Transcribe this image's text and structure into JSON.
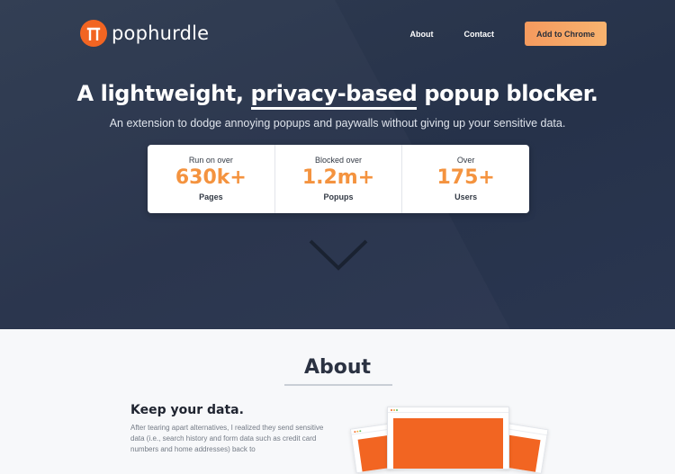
{
  "brand": {
    "name": "pophurdle",
    "accent": "#f26522",
    "cta_color": "#f7a866",
    "hero_bg": "#2b374d"
  },
  "nav": {
    "items": [
      "About",
      "Contact"
    ],
    "cta": "Add to Chrome"
  },
  "hero": {
    "headline_before": "A lightweight,",
    "headline_underlined": "privacy-based",
    "headline_after": "popup blocker.",
    "subhead": "An extension to dodge annoying popups and paywalls without giving up your sensitive data."
  },
  "stats": [
    {
      "top": "Run on over",
      "value": "630k+",
      "bottom": "Pages"
    },
    {
      "top": "Blocked over",
      "value": "1.2m+",
      "bottom": "Popups"
    },
    {
      "top": "Over",
      "value": "175+",
      "bottom": "Users"
    }
  ],
  "icons": {
    "logo": "door-frame-icon",
    "scroll": "chevron-down-icon"
  },
  "about": {
    "title": "About",
    "heading": "Keep your data.",
    "body": "After tearing apart alternatives, I realized they send sensitive data (i.e., search history and form data such as credit card numbers and home addresses) back to"
  }
}
